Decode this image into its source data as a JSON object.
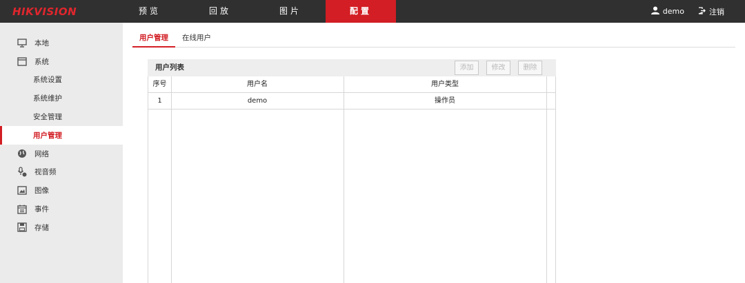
{
  "header": {
    "logo": "HIKVISION",
    "nav": [
      {
        "label": "预览"
      },
      {
        "label": "回放"
      },
      {
        "label": "图片"
      },
      {
        "label": "配置"
      }
    ],
    "username": "demo",
    "logout_label": "注销"
  },
  "sidebar": {
    "items": [
      {
        "label": "本地",
        "icon": "monitor-icon"
      },
      {
        "label": "系统",
        "icon": "window-icon"
      },
      {
        "label": "网络",
        "icon": "globe-icon"
      },
      {
        "label": "视音频",
        "icon": "mic-icon"
      },
      {
        "label": "图像",
        "icon": "image-icon"
      },
      {
        "label": "事件",
        "icon": "calendar-icon"
      },
      {
        "label": "存储",
        "icon": "floppy-icon"
      }
    ],
    "system_sub": [
      "系统设置",
      "系统维护",
      "安全管理",
      "用户管理"
    ]
  },
  "tabs": [
    {
      "label": "用户管理"
    },
    {
      "label": "在线用户"
    }
  ],
  "panel": {
    "title": "用户列表",
    "buttons": {
      "add": "添加",
      "modify": "修改",
      "delete": "删除"
    },
    "columns": [
      "序号",
      "用户名",
      "用户类型"
    ],
    "rows": [
      {
        "index": "1",
        "name": "demo",
        "type": "操作员"
      }
    ]
  },
  "colors": {
    "accent": "#d21e24",
    "topbar": "#303030",
    "sidebar_bg": "#ebebeb"
  }
}
